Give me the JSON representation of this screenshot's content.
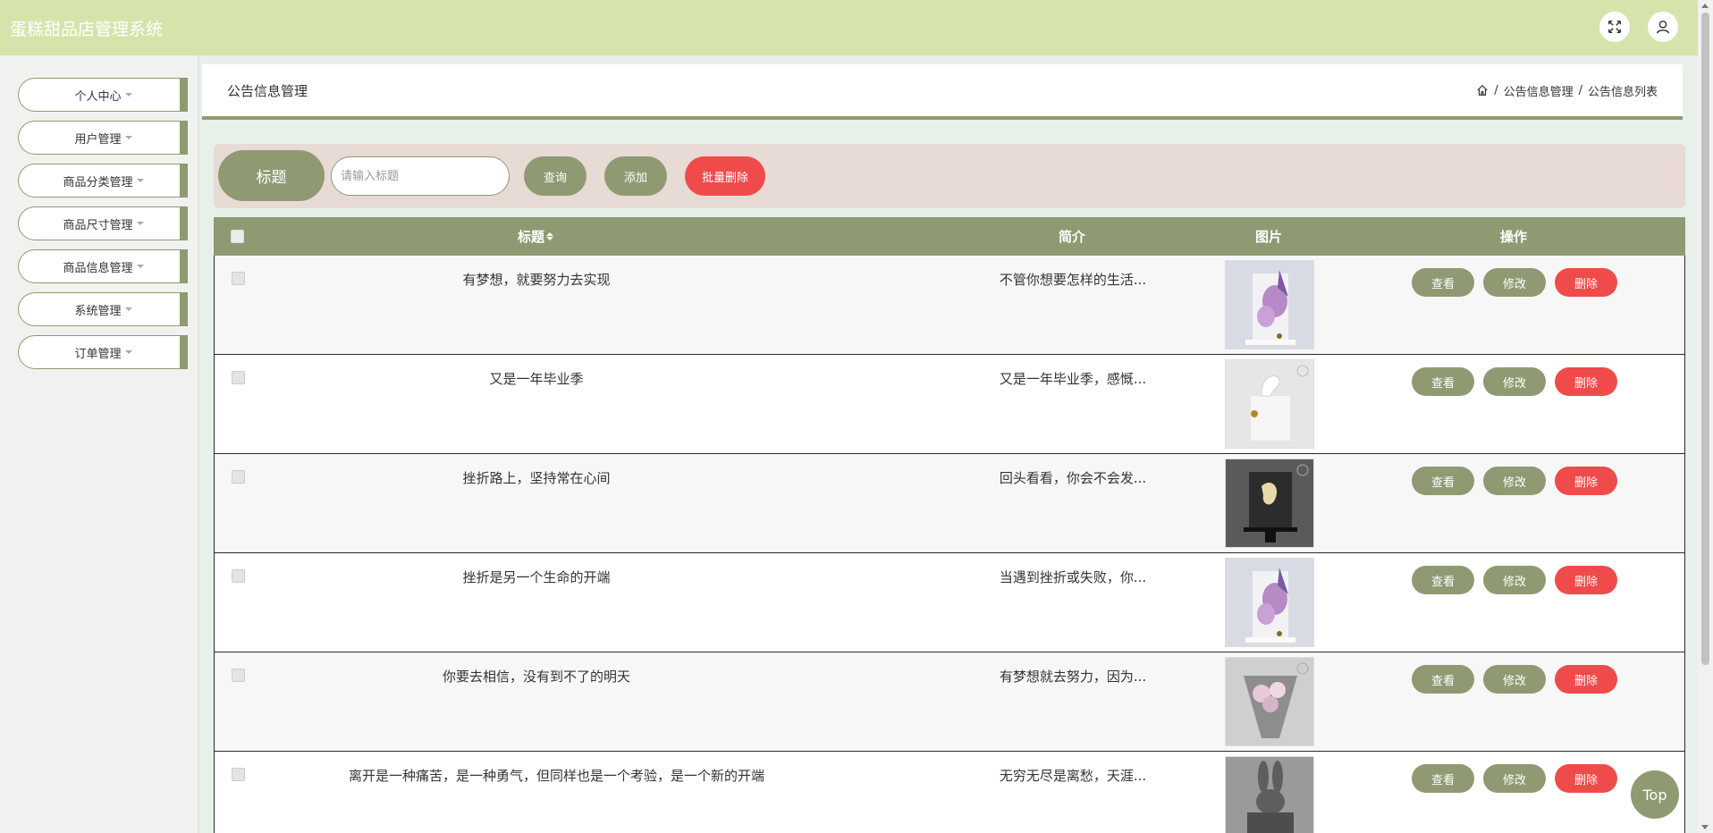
{
  "header": {
    "app_title": "蛋糕甜品店管理系统",
    "icons": [
      "fullscreen-icon",
      "user-icon"
    ]
  },
  "sidebar": {
    "items": [
      {
        "label": "个人中心"
      },
      {
        "label": "用户管理"
      },
      {
        "label": "商品分类管理"
      },
      {
        "label": "商品尺寸管理"
      },
      {
        "label": "商品信息管理"
      },
      {
        "label": "系统管理"
      },
      {
        "label": "订单管理"
      }
    ]
  },
  "page": {
    "title": "公告信息管理",
    "breadcrumb": [
      "公告信息管理",
      "公告信息列表"
    ],
    "breadcrumb_separator": "/"
  },
  "search": {
    "label": "标题",
    "placeholder": "请输入标题",
    "query_label": "查询",
    "add_label": "添加",
    "batch_delete_label": "批量删除"
  },
  "table": {
    "columns": {
      "title": "标题",
      "intro": "简介",
      "image": "图片",
      "actions": "操作"
    },
    "actions": {
      "view": "查看",
      "edit": "修改",
      "delete": "删除"
    },
    "rows": [
      {
        "title": "有梦想，就要努力去实现",
        "intro": "不管你想要怎样的生活...",
        "image": "cake-purple-flowers"
      },
      {
        "title": "又是一年毕业季",
        "intro": "又是一年毕业季，感慨...",
        "image": "cake-white-swan"
      },
      {
        "title": "挫折路上，坚持常在心间",
        "intro": "回头看看，你会不会发...",
        "image": "cake-black-gold"
      },
      {
        "title": "挫折是另一个生命的开端",
        "intro": "当遇到挫折或失败，你...",
        "image": "cake-purple-flowers"
      },
      {
        "title": "你要去相信，没有到不了的明天",
        "intro": "有梦想就去努力，因为...",
        "image": "cake-grey-bouquet"
      },
      {
        "title": "离开是一种痛苦，是一种勇气，但同样也是一个考验，是一个新的开端",
        "intro": "无穷无尽是离愁，天涯...",
        "image": "cake-grey-bunny"
      }
    ]
  },
  "top_button": "Top",
  "colors": {
    "header_bg": "#d6e4ab",
    "accent": "#8f9a72",
    "danger": "#f04b4b",
    "search_bar_bg": "#e8dad5"
  }
}
